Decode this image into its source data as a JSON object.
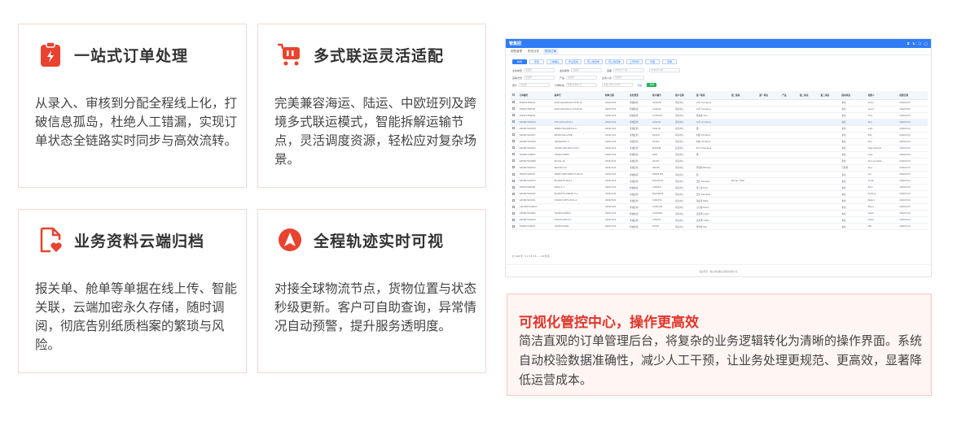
{
  "features": [
    {
      "title": "一站式订单处理",
      "desc": "从录入、审核到分配全程线上化，打破信息孤岛，杜绝人工错漏，实现订单状态全链路实时同步与高效流转。",
      "icon": "clipboard-bolt-icon"
    },
    {
      "title": "多式联运灵活适配",
      "desc": "完美兼容海运、陆运、中欧班列及跨境多式联运模式，智能拆解运输节点，灵活调度资源，轻松应对复杂场景。",
      "icon": "cart-icon"
    },
    {
      "title": "业务资料云端归档",
      "desc": "报关单、舱单等单据在线上传、智能关联，云端加密永久存储，随时调阅，彻底告别纸质档案的繁琐与风险。",
      "icon": "document-heart-icon"
    },
    {
      "title": "全程轨迹实时可视",
      "desc": "对接全球物流节点，货物位置与状态秒级更新。客户可自助查询，异常情况自动预警，提升服务透明度。",
      "icon": "navigation-arrow-icon"
    }
  ],
  "colors": {
    "accent": "#e8432f",
    "card_border": "#f3d8d2",
    "callout_bg": "#fff5f3",
    "app_blue": "#2f7cf6"
  },
  "callout": {
    "title": "可视化管控中心，操作更高效",
    "desc": "简洁直观的订单管理后台，将复杂的业务逻辑转化为清晰的操作界面。系统自动校验数据准确性，减少人工干预，让业务处理更规范、更高效，显著降低运营成本。"
  },
  "screenshot": {
    "app_title": "管集团",
    "tools": [
      "⌗",
      "↻",
      "⛶",
      "◯"
    ],
    "crumbs": [
      {
        "label": "销售管理",
        "on": false
      },
      {
        "label": "物流业务",
        "on": false
      },
      {
        "label": "物流订单",
        "on": true
      }
    ],
    "buttons": [
      "新增",
      "修改",
      "订单确认",
      "作业回单",
      "导入物流单",
      "导入物流单",
      "上传附件",
      "作废",
      "查看"
    ],
    "filters_row1": [
      [
        "业务类型",
        "请选择"
      ],
      [
        "发货类型",
        "请选择"
      ],
      [
        "运期",
        "2026-07-26"
      ],
      [
        "",
        "2026-07-26"
      ]
    ],
    "filters_row2": [
      [
        "运输方式",
        "请选择"
      ],
      [
        "产品",
        "请选择"
      ],
      [
        "业务人员",
        "请选择"
      ]
    ],
    "filters_row3": [
      [
        "客户",
        "请选择"
      ],
      [
        "订单状态",
        "所属,未审核,已..."
      ],
      [
        "",
        "请输入单号,订单号"
      ]
    ],
    "query_label": "查询",
    "reset_label": "重置",
    "columns": [
      "订单编号",
      "提单号",
      "制单日期",
      "业务类型",
      "客户编号",
      "客户名称",
      "第一联系",
      "第二联系",
      "第一承运",
      "产品",
      "第二承运",
      "第三承运",
      "国内承运",
      "创建人",
      "创建日期"
    ],
    "rows": [
      [
        "TP2607250001",
        "KLWC/A6226/120-0726-24",
        "2026/7/25",
        "传统快递",
        "C24D26",
        "海宜中心",
        "公司 Company",
        "",
        "",
        "",
        "",
        "",
        "未知",
        "Amy1",
        "2026/7/25"
      ],
      [
        "TP2607250002",
        "KLWC/A6226/121-0726-30",
        "2026/7/25",
        "传统快递",
        "C24D26",
        "海宜中心",
        "公司 Company",
        "",
        "",
        "",
        "",
        "",
        "未知",
        "Amy1",
        "2026/7/25"
      ],
      [
        "TP2607250003",
        "",
        "2026/7/25",
        "传统快递",
        "C27D232",
        "海宜中心",
        "风语林 Tina",
        "",
        "",
        "",
        "",
        "",
        "未知",
        "Tina",
        "2026/7/25"
      ],
      [
        "GP2607240019",
        "155-1131-0724-1",
        "2026/7/24",
        "专线定制",
        "K29135",
        "海宜中心",
        "公司 Company",
        "",
        "",
        "",
        "",
        "",
        "未知",
        "Ziqi",
        "2026/7/24"
      ],
      [
        "GP2607240018",
        "988807261688722-0",
        "2026/7/24",
        "专线定制",
        "K29176",
        "海宜中心",
        "潘",
        "",
        "",
        "",
        "",
        "",
        "未知",
        "Lily1",
        "2026/7/24"
      ],
      [
        "GP2607240017",
        "PN4452A6-A-P4B",
        "2026/7/24",
        "专线定制",
        "RC108",
        "海宜中心",
        "刘丽 Christine",
        "",
        "",
        "",
        "",
        "",
        "未知",
        "Ella",
        "2026/7/24"
      ],
      [
        "GP2607240016",
        "YN6D42501-3",
        "2026/7/24",
        "专线定制",
        "RC100",
        "海宜中心",
        "刘丽 Christine",
        "",
        "",
        "",
        "",
        "",
        "未知",
        "Ziqi",
        "2026/7/24"
      ],
      [
        "GP2607240015",
        "YM-6FK-180-690-0725-7",
        "2026/7/24",
        "专线定制",
        "M23596",
        "宏昌中心",
        "Emil Shamaes",
        "",
        "",
        "",
        "",
        "",
        "未知",
        "Olga Salema",
        "2026/7/24"
      ],
      [
        "TZ2607240003",
        "TZ260724003",
        "2026/7/24",
        "传统快递",
        "K4P1",
        "海宜中心",
        "潘",
        "",
        "",
        "",
        "",
        "",
        "未知",
        "Lily1",
        "2026/7/24"
      ],
      [
        "GP2607240008",
        "RC2G1-10",
        "2026/7/24",
        "专线定制",
        "RC103",
        "海宜中心",
        "",
        "",
        "",
        "",
        "",
        "",
        "未知",
        "Duo Andriela",
        "2026/7/24"
      ],
      [
        "GP2607240014",
        "NJ6C3S4-12",
        "2026/7/24",
        "专线定制",
        "RAD18",
        "海宜中心",
        "尹者莉 Nikolay",
        "",
        "",
        "",
        "",
        "",
        "已处理",
        "Ziqi",
        "2026/7/24"
      ],
      [
        "TP2607240007",
        "A0685-HWC32807/2-001-4",
        "2026/7/24",
        "传统快递",
        "P4626162",
        "海宜中心",
        "陈",
        "",
        "",
        "",
        "",
        "",
        "未知",
        "Leo",
        "2026/7/24"
      ],
      [
        "GP2607240013",
        "RC240197-004-1",
        "2026/7/24",
        "专线定制",
        "RC240197",
        "海宜中心",
        "思杰 Danielle",
        "Roman Tilter",
        "",
        "",
        "",
        "",
        "未知",
        "Anita",
        "2026/7/24"
      ],
      [
        "TP2607240005",
        "ZSKG-3-1",
        "2026/7/24",
        "传统快递",
        "C3606/4",
        "海宜中心",
        "张王者 Echo",
        "",
        "",
        "",
        "",
        "",
        "未知",
        "Echo",
        "2026/7/24"
      ],
      [
        "GP2607240012",
        "RC240574-496/59-3-1",
        "2026/7/24",
        "专线定制",
        "RC240574",
        "海宜中心",
        "思杰 Danielae",
        "",
        "",
        "",
        "",
        "",
        "未知",
        "Kristina",
        "2026/7/24"
      ],
      [
        "GP2607240011",
        "C260271-BF7-0721-2",
        "2026/7/24",
        "专线定制",
        "C260271",
        "海宜中心",
        "孙晶洋 Peter",
        "",
        "",
        "",
        "",
        "",
        "未知",
        "Peter1",
        "2026/7/24"
      ],
      [
        "AAC2607240003",
        "",
        "2026/7/24",
        "专线定制",
        "C24D146",
        "海宜中心",
        "元灯康 Elena",
        "",
        "",
        "",
        "",
        "",
        "未知",
        "Elena",
        "2026/7/24"
      ],
      [
        "GP2607240002",
        "TZ2607240002",
        "2026/7/24",
        "传统快递",
        "C2V0026",
        "海宜中心",
        "高清泽 Adam",
        "",
        "",
        "",
        "",
        "",
        "未知",
        "Adam",
        "2026/7/24"
      ],
      [
        "GP2607240010",
        "C2S076-003-0-1",
        "2026/7/24",
        "专线定制",
        "C2S076",
        "海宜中心",
        "高清泽 Adam",
        "",
        "",
        "",
        "",
        "",
        "未知",
        "Adam",
        "2026/7/24"
      ],
      [
        "TZ2607240001",
        "TZ260724001",
        "2026/7/24",
        "传统快递",
        "KCF65",
        "海宜中心",
        "伴洋佳 Mia",
        "",
        "",
        "",
        "",
        "",
        "未知",
        "Mia",
        "2026/7/24"
      ]
    ],
    "selected_row": 3,
    "pager": "共 1/24 条   ‹  1  2  3  4  5  6  ...  ›   10 条/页",
    "footer": "版权所有：佛山市招骥信息科技有限公司"
  }
}
